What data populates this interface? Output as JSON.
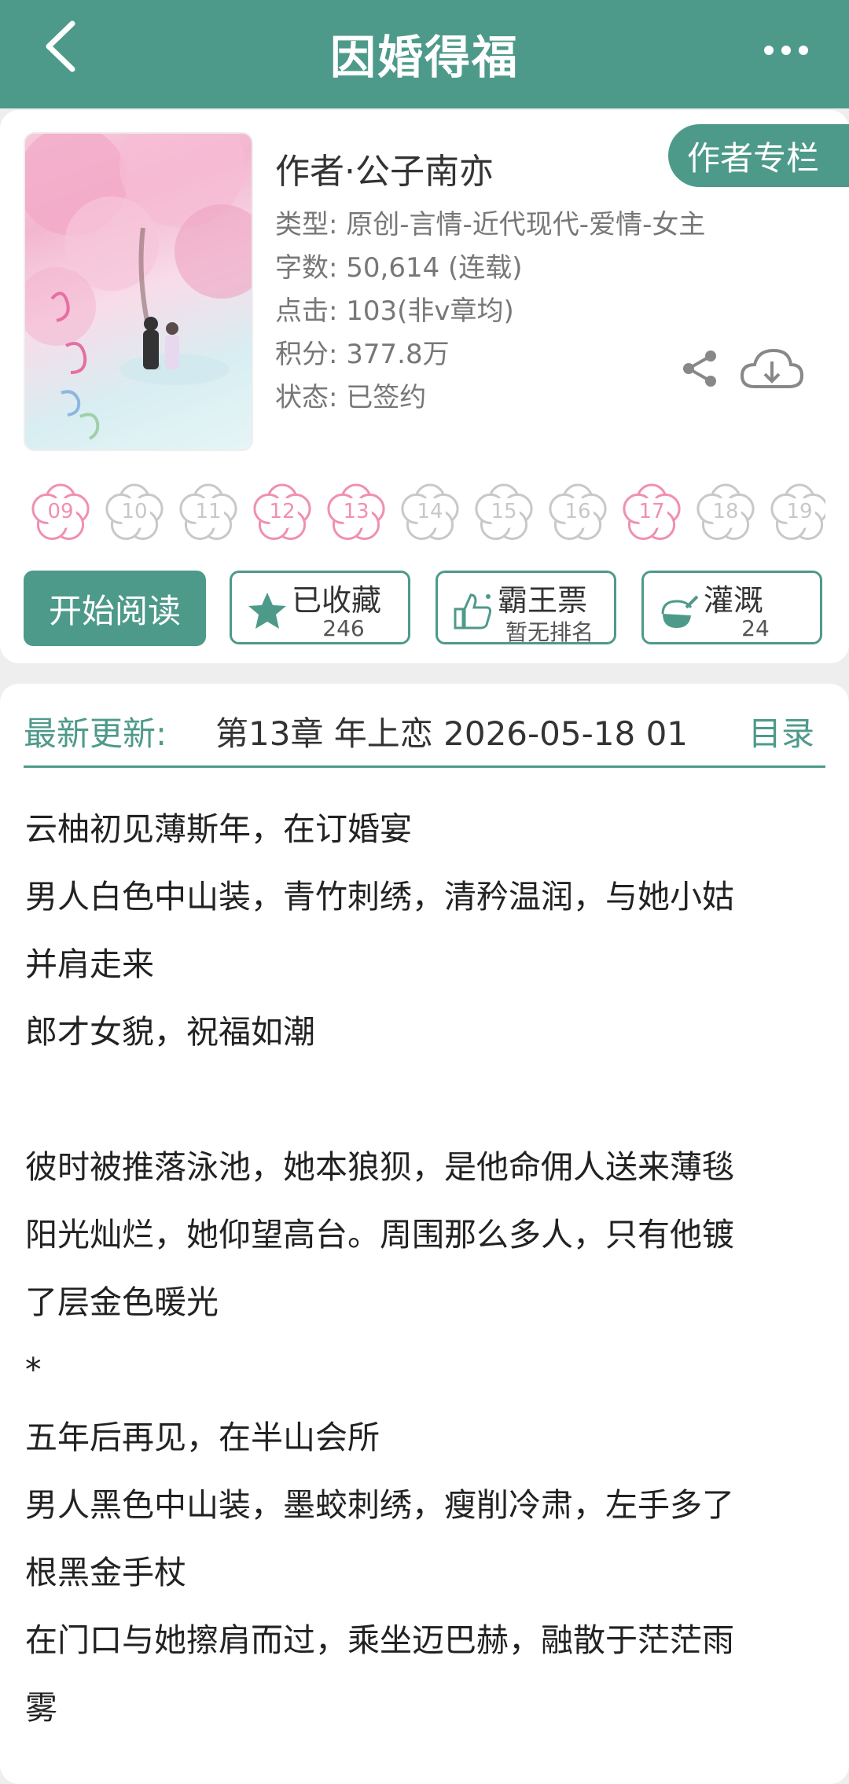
{
  "header": {
    "title": "因婚得福"
  },
  "book": {
    "author_line": "作者·公子南亦",
    "author_column_label": "作者专栏",
    "meta": [
      "类型: 原创-言情-近代现代-爱情-女主",
      "字数: 50,614 (连载)",
      "点击: 103(非v章均)",
      "积分: 377.8万",
      "状态: 已签约"
    ]
  },
  "flowers": [
    {
      "label": "09",
      "active": true
    },
    {
      "label": "10",
      "active": false
    },
    {
      "label": "11",
      "active": false
    },
    {
      "label": "12",
      "active": true
    },
    {
      "label": "13",
      "active": true
    },
    {
      "label": "14",
      "active": false
    },
    {
      "label": "15",
      "active": false
    },
    {
      "label": "16",
      "active": false
    },
    {
      "label": "17",
      "active": true
    },
    {
      "label": "18",
      "active": false
    },
    {
      "label": "19",
      "active": false
    }
  ],
  "colors": {
    "accent": "#4e9a8a",
    "flower_active": "#f08fb3",
    "flower_inactive": "#c8c8c8"
  },
  "actions": {
    "read_label": "开始阅读",
    "collect": {
      "label": "已收藏",
      "count": "246",
      "icon": "star-icon"
    },
    "vote": {
      "label": "霸王票",
      "sub": "暂无排名",
      "icon": "thumbs-up-icon"
    },
    "water": {
      "label": "灌溉",
      "count": "24",
      "icon": "nutrient-bottle-icon"
    }
  },
  "latest": {
    "label": "最新更新:",
    "chapter": "第13章  年上恋  2026-05-18 01",
    "toc_label": "目录"
  },
  "intro": [
    "云柚初见薄斯年，在订婚宴",
    "男人白色中山装，青竹刺绣，清矜温润，与她小姑",
    "并肩走来",
    "郎才女貌，祝福如潮",
    "",
    "彼时被推落泳池，她本狼狈，是他命佣人送来薄毯",
    "阳光灿烂，她仰望高台。周围那么多人，只有他镀",
    "了层金色暖光",
    "*",
    "五年后再见，在半山会所",
    "男人黑色中山装，墨蛟刺绣，瘦削冷肃，左手多了",
    "根黑金手杖",
    "在门口与她擦肩而过，乘坐迈巴赫，融散于茫茫雨",
    "雾"
  ]
}
